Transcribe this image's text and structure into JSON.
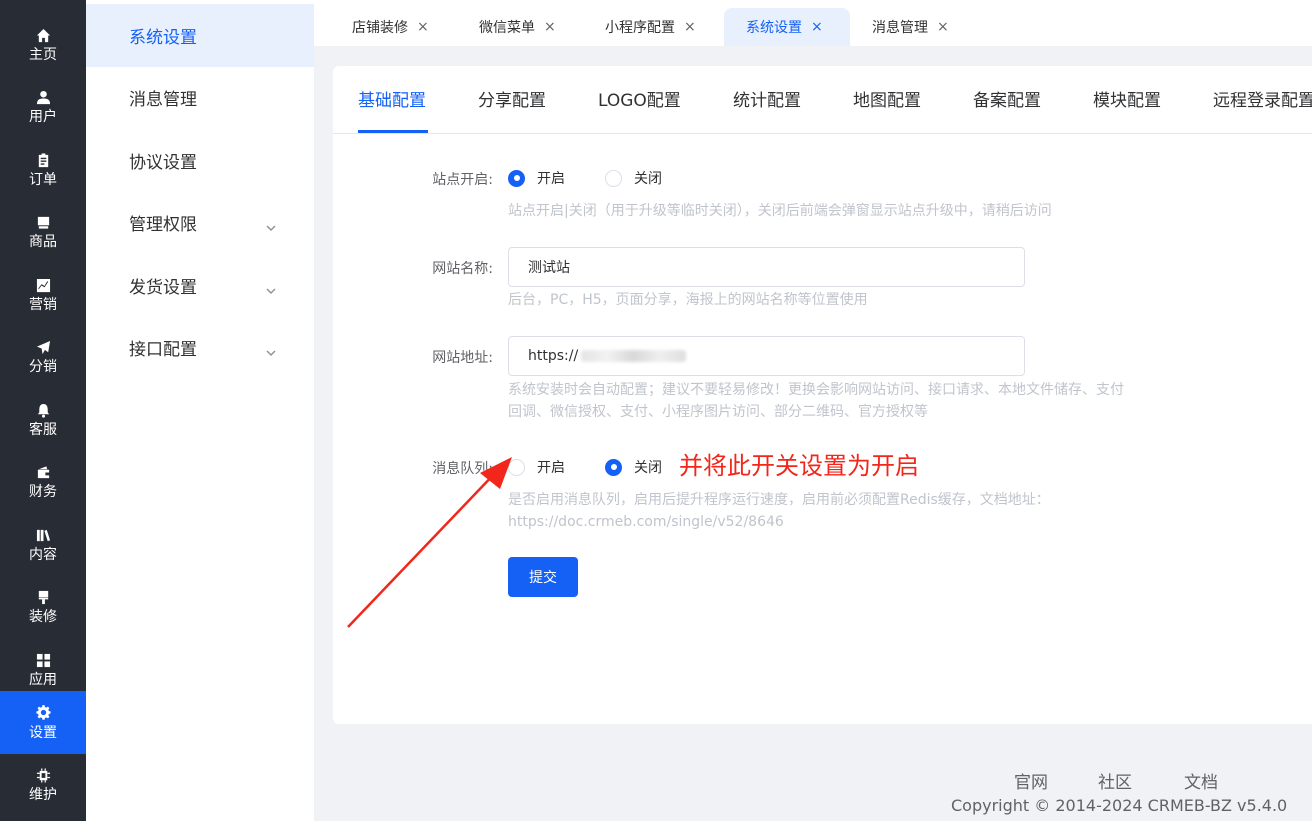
{
  "nav": {
    "items": [
      {
        "label": "主页",
        "icon": "home-icon"
      },
      {
        "label": "用户",
        "icon": "user-icon"
      },
      {
        "label": "订单",
        "icon": "order-icon"
      },
      {
        "label": "商品",
        "icon": "product-icon"
      },
      {
        "label": "营销",
        "icon": "marketing-icon"
      },
      {
        "label": "分销",
        "icon": "distribution-icon"
      },
      {
        "label": "客服",
        "icon": "bell-icon"
      },
      {
        "label": "财务",
        "icon": "wallet-icon"
      },
      {
        "label": "内容",
        "icon": "book-icon"
      },
      {
        "label": "装修",
        "icon": "brush-icon"
      },
      {
        "label": "应用",
        "icon": "grid-icon"
      },
      {
        "label": "设置",
        "icon": "gear-icon"
      },
      {
        "label": "维护",
        "icon": "chip-icon"
      }
    ],
    "active": "设置"
  },
  "submenu": {
    "items": [
      {
        "label": "系统设置"
      },
      {
        "label": "消息管理"
      },
      {
        "label": "协议设置"
      },
      {
        "label": "管理权限"
      },
      {
        "label": "发货设置"
      },
      {
        "label": "接口配置"
      }
    ]
  },
  "tabs": {
    "items": [
      {
        "label": "店铺装修",
        "close": "×"
      },
      {
        "label": "微信菜单",
        "close": "×"
      },
      {
        "label": "小程序配置",
        "close": "×"
      },
      {
        "label": "系统设置",
        "close": "×"
      },
      {
        "label": "消息管理",
        "close": "×"
      }
    ]
  },
  "config_tabs": {
    "items": [
      {
        "label": "基础配置"
      },
      {
        "label": "分享配置"
      },
      {
        "label": "LOGO配置"
      },
      {
        "label": "统计配置"
      },
      {
        "label": "地图配置"
      },
      {
        "label": "备案配置"
      },
      {
        "label": "模块配置"
      },
      {
        "label": "远程登录配置"
      }
    ]
  },
  "form": {
    "site_open": {
      "label": "站点开启:",
      "on": "开启",
      "off": "关闭",
      "value": "开启",
      "help": "站点开启|关闭（用于升级等临时关闭），关闭后前端会弹窗显示站点升级中，请稍后访问"
    },
    "site_name": {
      "label": "网站名称:",
      "value": "测试站",
      "help": "后台，PC，H5，页面分享，海报上的网站名称等位置使用"
    },
    "site_url": {
      "label": "网站地址:",
      "value": "https://",
      "help_line1": "系统安装时会自动配置；建议不要轻易修改！更换会影响网站访问、接口请求、本地文件储存、支付",
      "help_line2": "回调、微信授权、支付、小程序图片访问、部分二维码、官方授权等"
    },
    "message_queue": {
      "label": "消息队列:",
      "on": "开启",
      "off": "关闭",
      "value": "关闭",
      "help_line1": "是否启用消息队列，启用后提升程序运行速度，启用前必须配置Redis缓存，文档地址：",
      "help_line2": "https://doc.crmeb.com/single/v52/8646"
    },
    "submit_label": "提交"
  },
  "annotation": {
    "text": "并将此开关设置为开启",
    "color": "#f2261a"
  },
  "footer": {
    "links": [
      "官网",
      "社区",
      "文档"
    ],
    "copyright": "Copyright © 2014-2024 CRMEB-BZ v5.4.0"
  },
  "colors": {
    "primary": "#1561f5",
    "nav_bg": "#282c34"
  }
}
